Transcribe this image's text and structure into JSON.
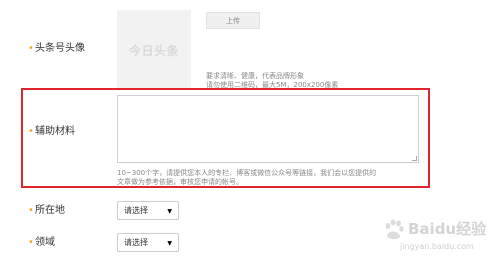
{
  "avatar": {
    "label": "头条号头像",
    "placeholder_logo": "今日头条",
    "upload_label": "上传",
    "hint_line1": "要求清晰、健康，代表品牌形象",
    "hint_line2": "请勿使用二维码，最大5M，200x200像素"
  },
  "materials": {
    "label": "辅助材料",
    "value": "",
    "hint_line1": "10~300个字，请提供您本人的专栏、博客或微信公众号等链接，我们会以您提供的",
    "hint_line2": "文章做为参考依据，审核您申请的帐号。",
    "highlight_color": "#e0262d"
  },
  "location": {
    "label": "所在地",
    "selected": "请选择"
  },
  "domain_field": {
    "label": "领域",
    "selected": "请选择"
  },
  "watermark": {
    "brand": "Baidu经验",
    "url": "jingyan.baidu.com"
  },
  "colors": {
    "bullet": "#f5a623",
    "hint_text": "#888888"
  }
}
